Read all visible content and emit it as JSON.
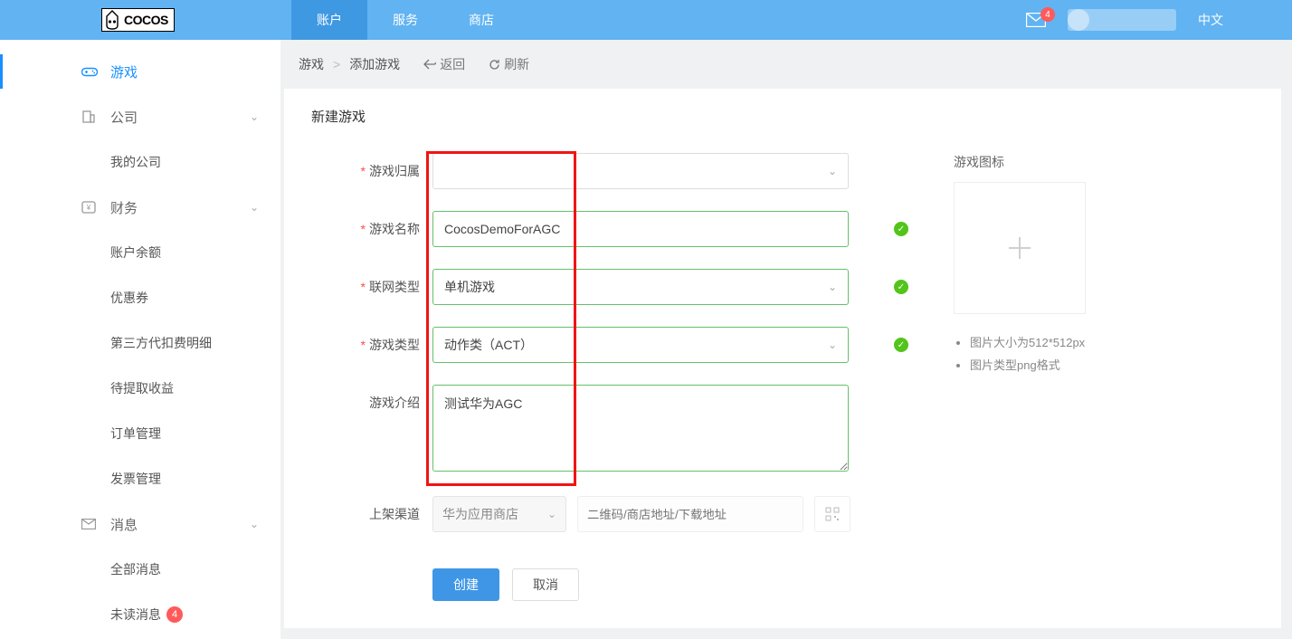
{
  "brand": "COCOS",
  "topnav": {
    "account": "账户",
    "service": "服务",
    "store": "商店"
  },
  "top_right": {
    "mail_badge": "4",
    "lang": "中文"
  },
  "sidebar": {
    "game": "游戏",
    "company": "公司",
    "my_company": "我的公司",
    "finance": "财务",
    "balance": "账户余额",
    "coupon": "优惠券",
    "thirdparty_fee": "第三方代扣费明细",
    "pending_income": "待提取收益",
    "order_mgmt": "订单管理",
    "invoice_mgmt": "发票管理",
    "message": "消息",
    "all_msg": "全部消息",
    "unread_msg": "未读消息",
    "unread_badge": "4"
  },
  "breadcrumb": {
    "game": "游戏",
    "add_game": "添加游戏",
    "back": "返回",
    "refresh": "刷新"
  },
  "panel": {
    "title": "新建游戏"
  },
  "form": {
    "owner_label": "游戏归属",
    "owner_value": "",
    "name_label": "游戏名称",
    "name_value": "CocosDemoForAGC",
    "net_label": "联网类型",
    "net_value": "单机游戏",
    "cat_label": "游戏类型",
    "cat_value": "动作类（ACT）",
    "intro_label": "游戏介绍",
    "intro_value": "测试华为AGC",
    "channel_label": "上架渠道",
    "channel_value": "华为应用商店",
    "channel_placeholder": "二维码/商店地址/下载地址"
  },
  "buttons": {
    "create": "创建",
    "cancel": "取消"
  },
  "aside": {
    "title": "游戏图标",
    "hints": [
      "图片大小为512*512px",
      "图片类型png格式"
    ]
  }
}
